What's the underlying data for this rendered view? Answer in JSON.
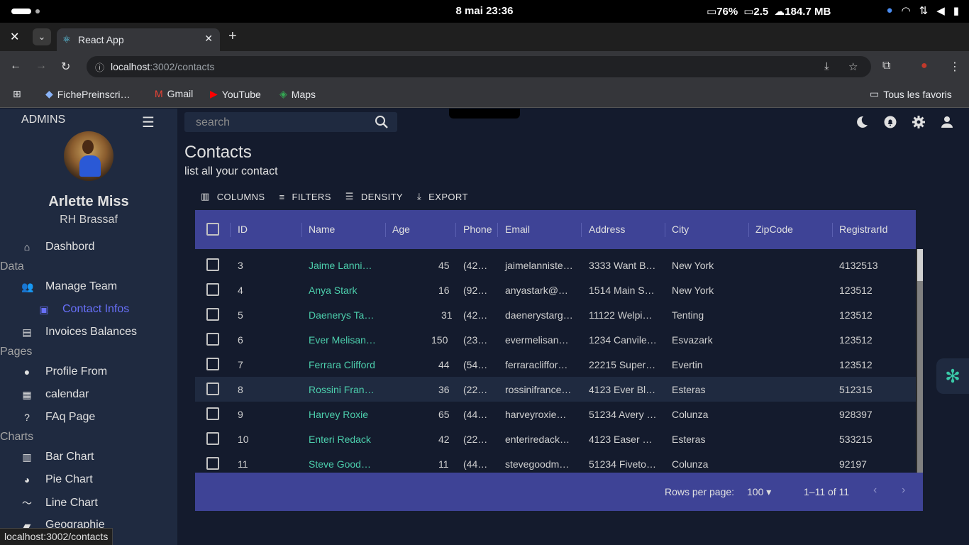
{
  "os": {
    "clock": "8 mai  23:36",
    "battery": "76%",
    "cpu": "2.5",
    "memory": "184.7 MB"
  },
  "browser": {
    "tab_title": "React App",
    "url_host": "localhost",
    "url_path": ":3002/contacts",
    "bookmarks": [
      "FichePreinscri…",
      "Gmail",
      "YouTube",
      "Maps"
    ],
    "all_bookmarks": "Tous les favoris",
    "status_url": "localhost:3002/contacts"
  },
  "sidebar": {
    "brand": "ADMINS",
    "user_name": "Arlette Miss",
    "user_role": "RH Brassaf",
    "items": [
      {
        "label": "Dashbord",
        "icon": "home-icon"
      },
      {
        "section": "Data"
      },
      {
        "label": "Manage Team",
        "icon": "people-icon"
      },
      {
        "label": "Contact Infos",
        "icon": "contacts-icon"
      },
      {
        "label": "Invoices Balances",
        "icon": "receipt-icon"
      },
      {
        "section": "Pages"
      },
      {
        "label": "Profile From",
        "icon": "person-icon"
      },
      {
        "label": "calendar",
        "icon": "calendar-icon"
      },
      {
        "label": "FAq Page",
        "icon": "help-icon"
      },
      {
        "section": "Charts"
      },
      {
        "label": "Bar Chart",
        "icon": "bar-chart-icon"
      },
      {
        "label": "Pie Chart",
        "icon": "pie-chart-icon"
      },
      {
        "label": "Line Chart",
        "icon": "line-chart-icon"
      },
      {
        "label": "Geographie",
        "icon": "map-icon"
      }
    ]
  },
  "topbar": {
    "search_placeholder": "search"
  },
  "header": {
    "title": "Contacts",
    "subtitle": "list all your contact"
  },
  "toolbar": {
    "columns": "COLUMNS",
    "filters": "FILTERS",
    "density": "DENSITY",
    "export": "EXPORT"
  },
  "table": {
    "columns": [
      "ID",
      "Name",
      "Age",
      "Phone",
      "Email",
      "Address",
      "City",
      "ZipCode",
      "RegistrarId"
    ],
    "rows": [
      {
        "id": "3",
        "name": "Jaime Lanni…",
        "age": "45",
        "phone": "(42…",
        "email": "jaimelanniste…",
        "address": "3333 Want B…",
        "city": "New York",
        "zip": "",
        "reg": "4132513"
      },
      {
        "id": "4",
        "name": "Anya Stark",
        "age": "16",
        "phone": "(92…",
        "email": "anyastark@…",
        "address": "1514 Main S…",
        "city": "New York",
        "zip": "",
        "reg": "123512"
      },
      {
        "id": "5",
        "name": "Daenerys Ta…",
        "age": "31",
        "phone": "(42…",
        "email": "daenerystarg…",
        "address": "11122 Welpi…",
        "city": "Tenting",
        "zip": "",
        "reg": "123512"
      },
      {
        "id": "6",
        "name": "Ever Melisan…",
        "age": "150",
        "phone": "(23…",
        "email": "evermelisan…",
        "address": "1234 Canvile…",
        "city": "Esvazark",
        "zip": "",
        "reg": "123512"
      },
      {
        "id": "7",
        "name": "Ferrara Clifford",
        "age": "44",
        "phone": "(54…",
        "email": "ferraracliffor…",
        "address": "22215 Super…",
        "city": "Evertin",
        "zip": "",
        "reg": "123512"
      },
      {
        "id": "8",
        "name": "Rossini Fran…",
        "age": "36",
        "phone": "(22…",
        "email": "rossinifrance…",
        "address": "4123 Ever Bl…",
        "city": "Esteras",
        "zip": "",
        "reg": "512315"
      },
      {
        "id": "9",
        "name": "Harvey Roxie",
        "age": "65",
        "phone": "(44…",
        "email": "harveyroxie…",
        "address": "51234 Avery …",
        "city": "Colunza",
        "zip": "",
        "reg": "928397"
      },
      {
        "id": "10",
        "name": "Enteri Redack",
        "age": "42",
        "phone": "(22…",
        "email": "enteriredack…",
        "address": "4123 Easer …",
        "city": "Esteras",
        "zip": "",
        "reg": "533215"
      },
      {
        "id": "11",
        "name": "Steve Good…",
        "age": "11",
        "phone": "(44…",
        "email": "stevegoodm…",
        "address": "51234 Fiveto…",
        "city": "Colunza",
        "zip": "",
        "reg": "92197"
      }
    ],
    "rows_per_page_label": "Rows per page:",
    "rows_per_page": "100",
    "range": "1–11 of 11"
  },
  "colors": {
    "accent": "#4cceac",
    "header_bg": "#3e4396",
    "sidebar_bg": "#1f2a40",
    "page_bg": "#141b2d",
    "active_menu": "#6870fa"
  }
}
